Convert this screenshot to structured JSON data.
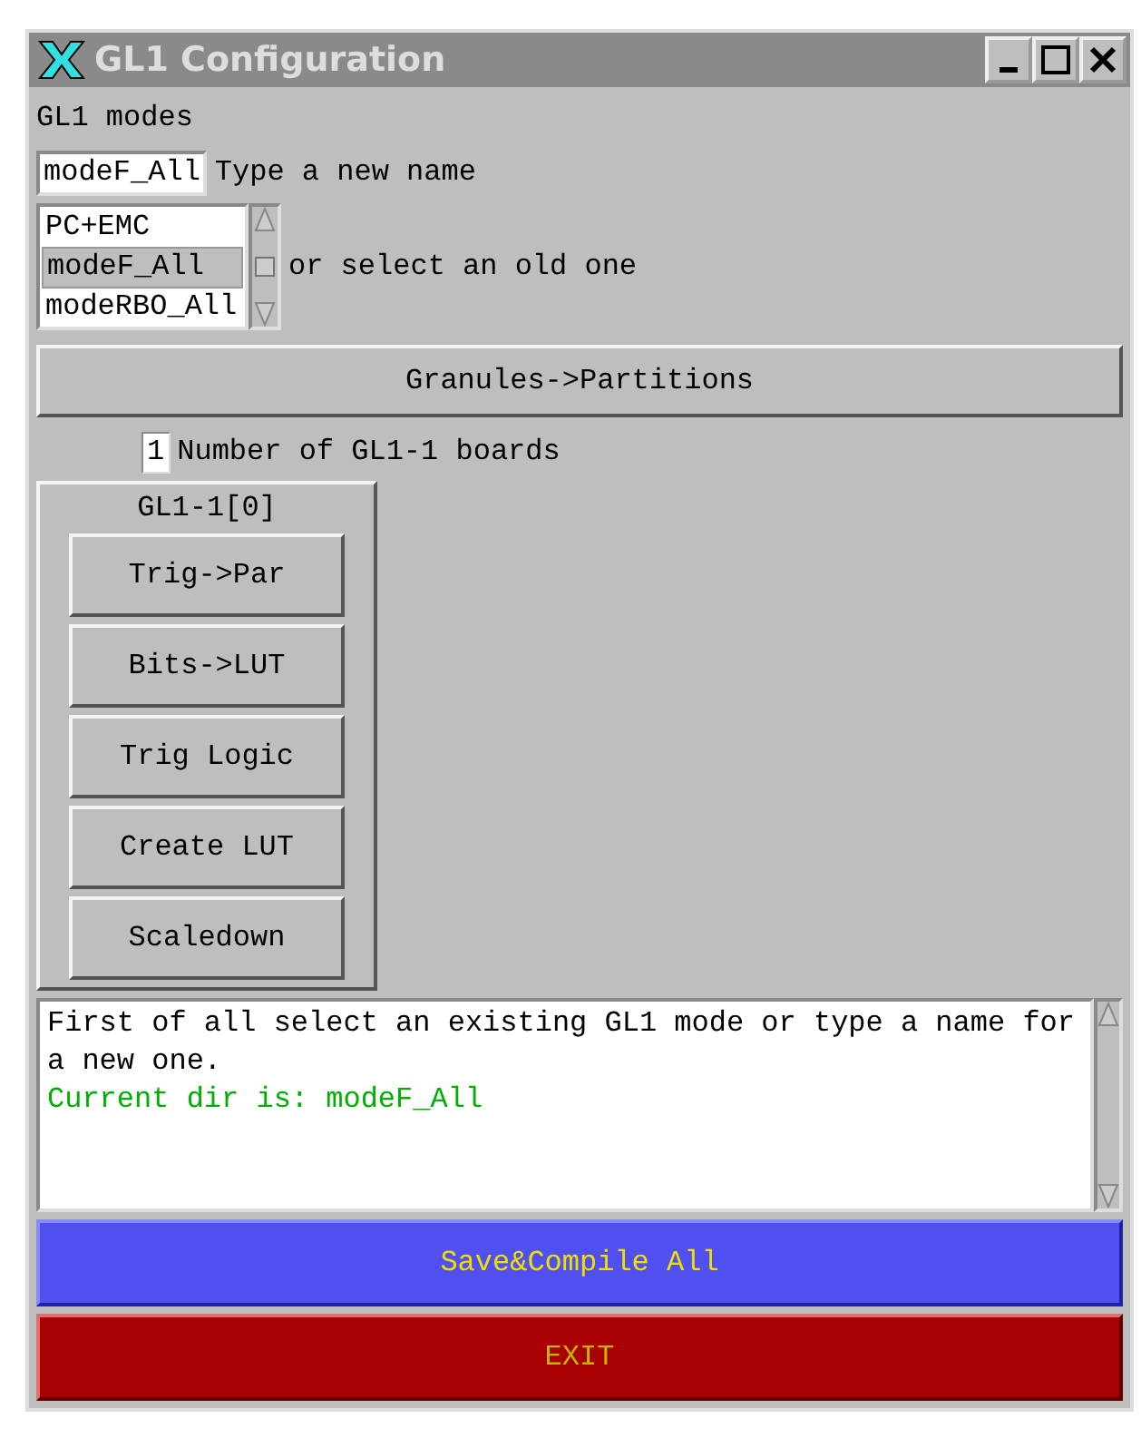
{
  "window": {
    "title": "GL1 Configuration"
  },
  "modes_label": "GL1 modes",
  "name_field": {
    "value": "modeF_All",
    "label": "Type a new name"
  },
  "mode_list": {
    "items": [
      {
        "label": "PC+EMC",
        "selected": false
      },
      {
        "label": "modeF_All",
        "selected": true
      },
      {
        "label": "modeRBO_All",
        "selected": false
      }
    ],
    "label": "or select an old one"
  },
  "granules_button": "Granules->Partitions",
  "boards": {
    "value": "1",
    "label": "Number of GL1-1 boards"
  },
  "board_group": {
    "title": "GL1-1[0]",
    "buttons": [
      "Trig->Par",
      "Bits->LUT",
      "Trig Logic",
      "Create LUT",
      "Scaledown"
    ]
  },
  "log": [
    {
      "text": "First of all select an existing GL1 mode or type a name for a new one.",
      "color": "#000000"
    },
    {
      "text": "Current dir is: modeF_All",
      "color": "#00b000"
    }
  ],
  "save_button": "Save&Compile All",
  "exit_button": "EXIT"
}
